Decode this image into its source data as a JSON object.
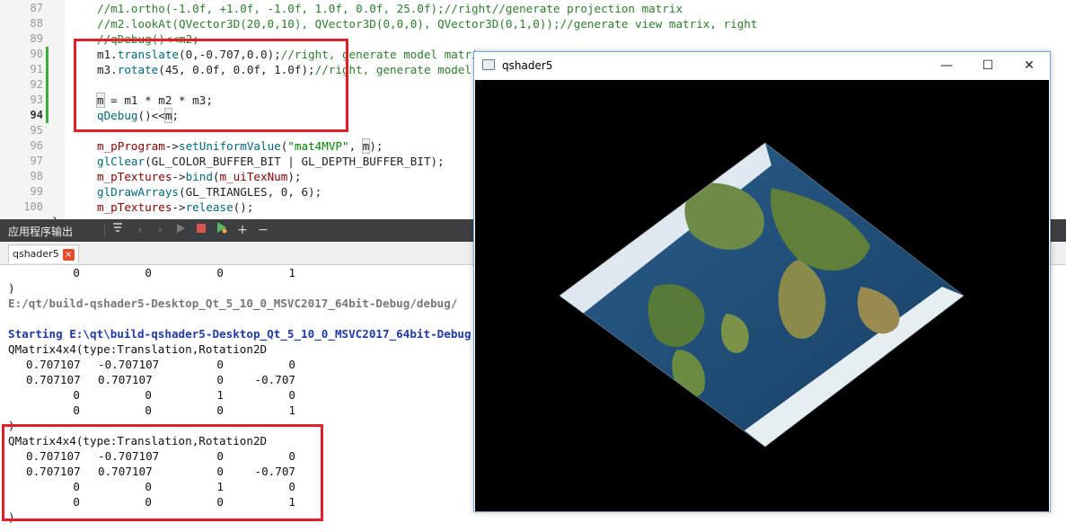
{
  "editor": {
    "lines": [
      {
        "num": "87",
        "segments": [
          {
            "t": "//m1.ortho(-1.0f, +1.0f, -1.0f, 1.0f, 0.0f, 25.0f);//right//generate projection matrix",
            "c": "c-comment"
          }
        ]
      },
      {
        "num": "88",
        "segments": [
          {
            "t": "//m2.lookAt(QVector3D(20,0,10), QVector3D(0,0,0), QVector3D(0,1,0));//generate view matrix, right",
            "c": "c-comment"
          }
        ]
      },
      {
        "num": "89",
        "segments": [
          {
            "t": "//qDebug()<<m2;",
            "c": "c-comment"
          }
        ]
      },
      {
        "num": "90",
        "segments": [
          {
            "t": "m1.",
            "c": ""
          },
          {
            "t": "translate",
            "c": "c-fn"
          },
          {
            "t": "(0,-0.707,0.0);",
            "c": ""
          },
          {
            "t": "//right, generate model matrix",
            "c": "c-comment"
          }
        ]
      },
      {
        "num": "91",
        "segments": [
          {
            "t": "m3.",
            "c": ""
          },
          {
            "t": "rotate",
            "c": "c-fn"
          },
          {
            "t": "(45, 0.0f, 0.0f, 1.0f);",
            "c": ""
          },
          {
            "t": "//right, generate model matrix",
            "c": "c-comment"
          }
        ]
      },
      {
        "num": "92",
        "segments": []
      },
      {
        "num": "93",
        "segments": [
          {
            "t": "m",
            "c": "c-hl"
          },
          {
            "t": " = m1 * m2 * m3;",
            "c": ""
          }
        ]
      },
      {
        "num": "94",
        "current": true,
        "segments": [
          {
            "t": "qDebug",
            "c": "c-fn"
          },
          {
            "t": "()<<",
            "c": ""
          },
          {
            "t": "m",
            "c": "c-hl"
          },
          {
            "t": ";",
            "c": ""
          }
        ]
      },
      {
        "num": "95",
        "segments": []
      },
      {
        "num": "96",
        "segments": [
          {
            "t": "m_pProgram",
            "c": "c-member"
          },
          {
            "t": "->",
            "c": ""
          },
          {
            "t": "setUniformValue",
            "c": "c-fn"
          },
          {
            "t": "(",
            "c": ""
          },
          {
            "t": "\"mat4MVP\"",
            "c": "c-str"
          },
          {
            "t": ", ",
            "c": ""
          },
          {
            "t": "m",
            "c": "c-hl"
          },
          {
            "t": ");",
            "c": ""
          }
        ]
      },
      {
        "num": "97",
        "segments": [
          {
            "t": "glClear",
            "c": "c-fn"
          },
          {
            "t": "(GL_COLOR_BUFFER_BIT | GL_DEPTH_BUFFER_BIT);",
            "c": ""
          }
        ]
      },
      {
        "num": "98",
        "segments": [
          {
            "t": "m_pTextures",
            "c": "c-member"
          },
          {
            "t": "->",
            "c": ""
          },
          {
            "t": "bind",
            "c": "c-fn"
          },
          {
            "t": "(",
            "c": ""
          },
          {
            "t": "m_uiTexNum",
            "c": "c-member"
          },
          {
            "t": ");",
            "c": ""
          }
        ]
      },
      {
        "num": "99",
        "segments": [
          {
            "t": "glDrawArrays",
            "c": "c-fn"
          },
          {
            "t": "(GL_TRIANGLES, 0, 6);",
            "c": ""
          }
        ]
      },
      {
        "num": "100",
        "segments": [
          {
            "t": "m_pTextures",
            "c": "c-member"
          },
          {
            "t": "->",
            "c": ""
          },
          {
            "t": "release",
            "c": "c-fn"
          },
          {
            "t": "();",
            "c": ""
          }
        ]
      }
    ],
    "trailing_brace": "}"
  },
  "output_pane": {
    "title": "应用程序输出",
    "tab_label": "qshader5",
    "tab_close": "×",
    "icons": [
      "filter-icon",
      "prev-icon",
      "next-icon",
      "run-icon",
      "stop-icon",
      "debug-run-icon",
      "add-icon",
      "remove-icon"
    ],
    "lines": [
      {
        "kind": "row",
        "cells": [
          "0",
          "0",
          "0",
          "1"
        ]
      },
      {
        "kind": "text",
        "text": ")",
        "cls": ""
      },
      {
        "kind": "text",
        "text": "E:/qt/build-qshader5-Desktop_Qt_5_10_0_MSVC2017_64bit-Debug/debug/",
        "cls": "path"
      },
      {
        "kind": "blank"
      },
      {
        "kind": "text",
        "text": "Starting E:\\qt\\build-qshader5-Desktop_Qt_5_10_0_MSVC2017_64bit-Debug",
        "cls": "starting"
      },
      {
        "kind": "text",
        "text": "QMatrix4x4(type:Translation,Rotation2D",
        "cls": ""
      },
      {
        "kind": "row",
        "cells": [
          "0.707107",
          "-0.707107",
          "0",
          "0"
        ]
      },
      {
        "kind": "row",
        "cells": [
          "0.707107",
          "0.707107",
          "0",
          "-0.707"
        ]
      },
      {
        "kind": "row",
        "cells": [
          "0",
          "0",
          "1",
          "0"
        ]
      },
      {
        "kind": "row",
        "cells": [
          "0",
          "0",
          "0",
          "1"
        ]
      },
      {
        "kind": "text",
        "text": ")",
        "cls": ""
      },
      {
        "kind": "text",
        "text": "QMatrix4x4(type:Translation,Rotation2D",
        "cls": ""
      },
      {
        "kind": "row",
        "cells": [
          "0.707107",
          "-0.707107",
          "0",
          "0"
        ]
      },
      {
        "kind": "row",
        "cells": [
          "0.707107",
          "0.707107",
          "0",
          "-0.707"
        ]
      },
      {
        "kind": "row",
        "cells": [
          "0",
          "0",
          "1",
          "0"
        ]
      },
      {
        "kind": "row",
        "cells": [
          "0",
          "0",
          "0",
          "1"
        ]
      },
      {
        "kind": "text",
        "text": ")",
        "cls": ""
      }
    ]
  },
  "window": {
    "title": "qshader5",
    "minimize": "—",
    "maximize": "☐",
    "close": "✕"
  },
  "colors": {
    "annotation": "#e0202a",
    "ocean": "#1f4f78",
    "land": "#5c7a3a",
    "ice": "#e6eef4"
  }
}
